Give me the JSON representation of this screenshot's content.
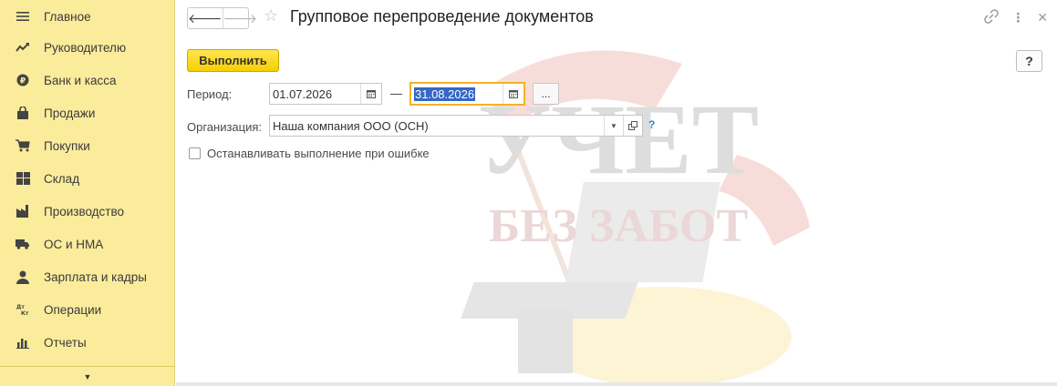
{
  "sidebar": {
    "items": [
      {
        "label": "Главное",
        "icon": "menu-icon"
      },
      {
        "label": "Руководителю",
        "icon": "trend-icon"
      },
      {
        "label": "Банк и касса",
        "icon": "ruble-icon"
      },
      {
        "label": "Продажи",
        "icon": "bag-icon"
      },
      {
        "label": "Покупки",
        "icon": "cart-icon"
      },
      {
        "label": "Склад",
        "icon": "warehouse-icon"
      },
      {
        "label": "Производство",
        "icon": "factory-icon"
      },
      {
        "label": "ОС и НМА",
        "icon": "truck-icon"
      },
      {
        "label": "Зарплата и кадры",
        "icon": "person-icon"
      },
      {
        "label": "Операции",
        "icon": "dt-kt-icon"
      },
      {
        "label": "Отчеты",
        "icon": "chart-icon"
      }
    ],
    "more_arrow": "▼"
  },
  "header": {
    "title": "Групповое перепроведение документов",
    "back_glyph": "🡐",
    "forward_glyph": "🡒",
    "star_glyph": "☆",
    "link_glyph": "🔗",
    "more_glyph": "⋮",
    "close_glyph": "✕"
  },
  "toolbar": {
    "execute_label": "Выполнить",
    "help_label": "?"
  },
  "form": {
    "period_label": "Период:",
    "date_from": "01.07.2026",
    "date_to": "31.08.2026",
    "dash": "—",
    "dots_label": "...",
    "org_label": "Организация:",
    "org_value": "Наша компания ООО (ОСН)",
    "org_help": "?",
    "stop_on_error_label": "Останавливать выполнение при ошибке",
    "stop_on_error_checked": false
  },
  "watermark": {
    "line1": "УЧЕТ",
    "line2": "БЕЗ ЗАБОТ"
  },
  "colors": {
    "sidebar_bg": "#fbec9c",
    "accent_button": "#f6d000",
    "focus_border": "#f4b324",
    "selection": "#3467c6"
  }
}
